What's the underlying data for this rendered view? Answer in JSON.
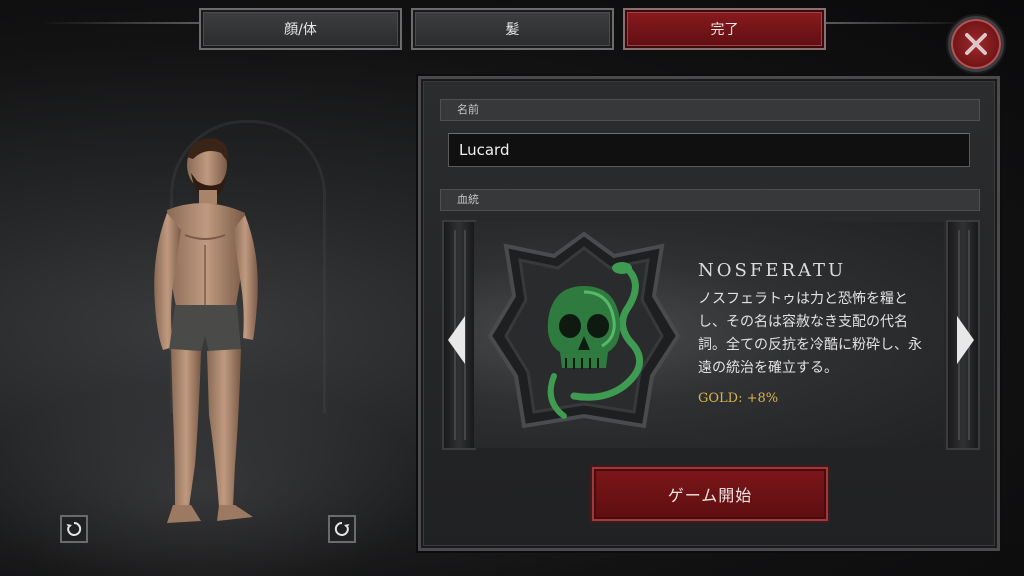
{
  "tabs": [
    {
      "label": "顔/体",
      "active": false
    },
    {
      "label": "髪",
      "active": false
    },
    {
      "label": "完了",
      "active": true
    }
  ],
  "close_icon": "close-x-icon",
  "form": {
    "name_label": "名前",
    "name_value": "Lucard",
    "bloodline_label": "血統"
  },
  "bloodline": {
    "name": "NOSFERATU",
    "description": "ノスフェラトゥは力と恐怖を糧とし、その名は容赦なき支配の代名詞。全ての反抗を冷酷に粉砕し、永遠の統治を確立する。",
    "bonus": "GOLD: +8%",
    "emblem_icon": "green-skull-serpent-crest-icon",
    "colors": {
      "emblem": "#3f9a52",
      "bonus": "#d9b64a"
    }
  },
  "start_button": "ゲーム開始",
  "colors": {
    "accent_red": "#7e1619",
    "panel": "#2b2c2e"
  }
}
